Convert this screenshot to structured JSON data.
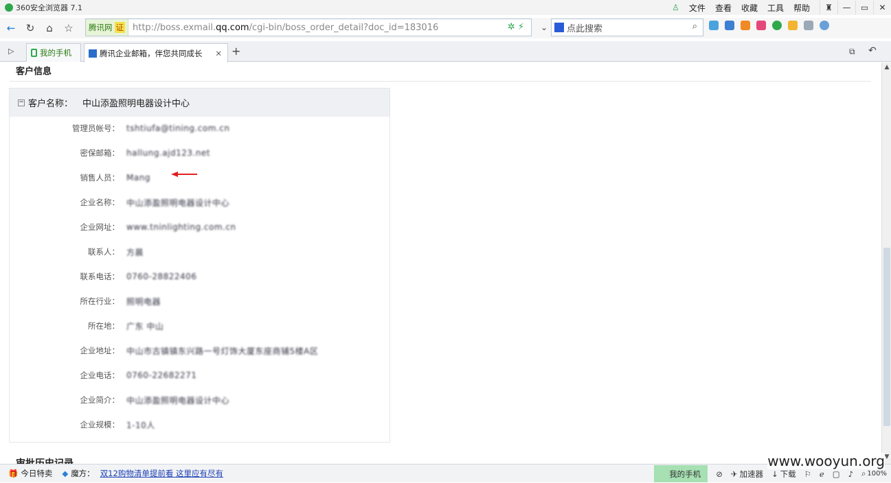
{
  "window": {
    "title": "360安全浏览器 7.1",
    "menu": [
      "文件",
      "查看",
      "收藏",
      "工具",
      "帮助"
    ]
  },
  "navbar": {
    "site_badge": "腾讯网",
    "cert_badge": "证",
    "url_prefix": "http://boss.exmail.",
    "url_domain": "qq.com",
    "url_path": "/cgi-bin/boss_order_detail?doc_id=183016",
    "search_placeholder": "点此搜索"
  },
  "tabs": [
    {
      "label": "我的手机"
    },
    {
      "label": "腾讯企业邮箱，伴您共同成长"
    }
  ],
  "page": {
    "section_title": "客户信息",
    "customer_label": "客户名称：",
    "customer_name": "中山添盈照明电器设计中心",
    "next_section_title": "审批历史记录",
    "fields": [
      {
        "label": "管理员帐号：",
        "value": "tshtiufa@tining.com.cn"
      },
      {
        "label": "密保邮箱：",
        "value": "hallung.ajd123.net"
      },
      {
        "label": "销售人员：",
        "value": "Mang"
      },
      {
        "label": "企业名称：",
        "value": "中山添盈照明电器设计中心"
      },
      {
        "label": "企业网址：",
        "value": "www.tninlighting.com.cn"
      },
      {
        "label": "联系人：",
        "value": "方晨"
      },
      {
        "label": "联系电话：",
        "value": "0760-28822406"
      },
      {
        "label": "所在行业：",
        "value": "照明电器"
      },
      {
        "label": "所在地：",
        "value": "广东 中山"
      },
      {
        "label": "企业地址：",
        "value": "中山市古镇镇东兴路一号灯饰大厦东座商铺5楼A区"
      },
      {
        "label": "企业电话：",
        "value": "0760-22682271"
      },
      {
        "label": "企业简介：",
        "value": "中山添盈照明电器设计中心"
      },
      {
        "label": "企业规模：",
        "value": "1-10人"
      }
    ]
  },
  "statusbar": {
    "today": "今日特卖",
    "magic": "魔方：",
    "promo_link": "双12购物清单提前看 这里应有尽有",
    "phone": "我的手机",
    "accelerator": "加速器",
    "download": "下载",
    "zoom": "100%"
  },
  "watermark": "www.wooyun.org",
  "colors": {
    "accent": "#2ea84b",
    "link": "#1a3fb5",
    "panel_head": "#eef0f3",
    "arrow": "#e02020"
  }
}
